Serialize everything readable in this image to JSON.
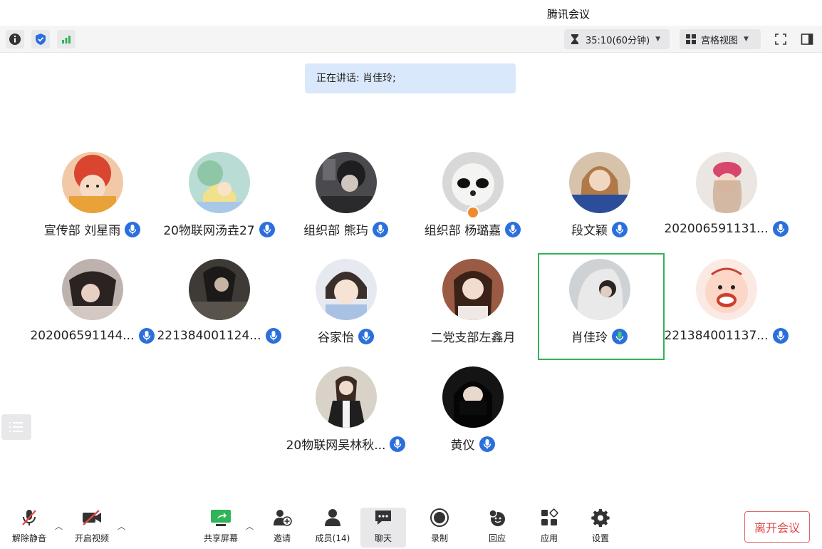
{
  "app": {
    "title": "腾讯会议"
  },
  "toolbar": {
    "timer": "35:10(60分钟)",
    "view_label": "宫格视图"
  },
  "speaking": {
    "text": "正在讲话: 肖佳玲;"
  },
  "participants": [
    {
      "name": "宣传部 刘星雨",
      "mic": "on"
    },
    {
      "name": "20物联网汤垚27",
      "mic": "on"
    },
    {
      "name": "组织部 熊玙",
      "mic": "on"
    },
    {
      "name": "组织部 杨璐嘉",
      "mic": "on"
    },
    {
      "name": "段文颖",
      "mic": "on"
    },
    {
      "name": "202006591131...",
      "mic": "on"
    },
    {
      "name": "202006591144...",
      "mic": "on"
    },
    {
      "name": "221384001124...",
      "mic": "on"
    },
    {
      "name": "谷家怡",
      "mic": "on"
    },
    {
      "name": "二党支部左鑫月",
      "mic": "none"
    },
    {
      "name": "肖佳玲",
      "mic": "speaking"
    },
    {
      "name": "221384001137...",
      "mic": "on"
    },
    {
      "name": "20物联网吴林秋...",
      "mic": "on"
    },
    {
      "name": "黄仪",
      "mic": "on"
    }
  ],
  "bottom": {
    "unmute": "解除静音",
    "start_video": "开启视频",
    "share": "共享屏幕",
    "invite": "邀请",
    "members": "成员(14)",
    "chat": "聊天",
    "record": "录制",
    "respond": "回应",
    "apps": "应用",
    "settings": "设置",
    "leave": "离开会议"
  },
  "colors": {
    "accent": "#2b6fdc",
    "speaking_green": "#2fb457",
    "leave_red": "#e04848",
    "speaking_bg": "#d9e8fb"
  }
}
